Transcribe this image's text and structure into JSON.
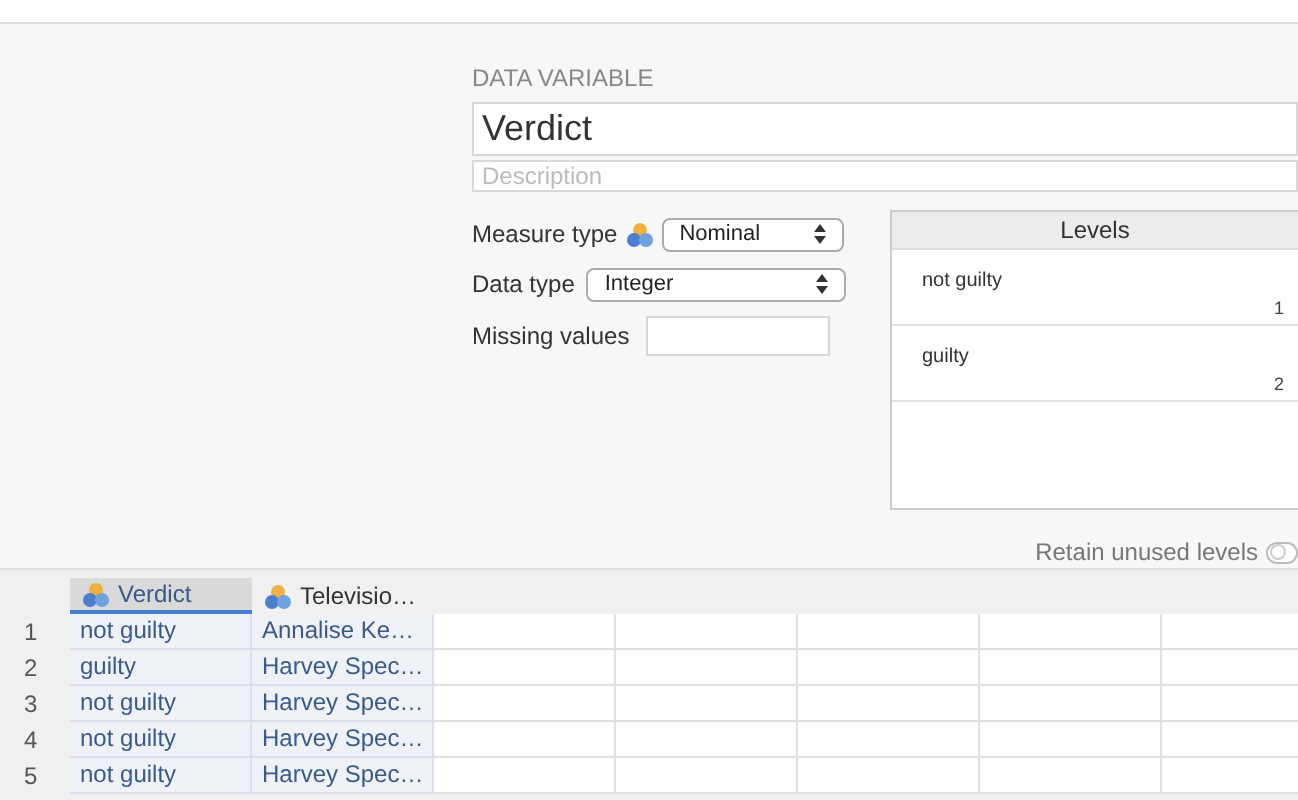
{
  "variable": {
    "section_title": "DATA VARIABLE",
    "name": "Verdict",
    "description_placeholder": "Description"
  },
  "measure_type": {
    "label": "Measure type",
    "value": "Nominal"
  },
  "data_type": {
    "label": "Data type",
    "value": "Integer"
  },
  "missing_values": {
    "label": "Missing values"
  },
  "levels": {
    "title": "Levels",
    "items": [
      {
        "label": "not guilty",
        "value": "1"
      },
      {
        "label": "guilty",
        "value": "2"
      }
    ]
  },
  "retain_unused_levels": {
    "label": "Retain unused levels",
    "on": false
  },
  "table": {
    "columns": [
      {
        "name": "Verdict",
        "selected": true
      },
      {
        "name": "Televisio…",
        "selected": false
      }
    ],
    "rows": [
      {
        "number": "1",
        "cells": [
          "not guilty",
          "Annalise Ke…"
        ]
      },
      {
        "number": "2",
        "cells": [
          "guilty",
          "Harvey Spec…"
        ]
      },
      {
        "number": "3",
        "cells": [
          "not guilty",
          "Harvey Spec…"
        ]
      },
      {
        "number": "4",
        "cells": [
          "not guilty",
          "Harvey Spec…"
        ]
      },
      {
        "number": "5",
        "cells": [
          "not guilty",
          "Harvey Spec…"
        ]
      }
    ]
  }
}
